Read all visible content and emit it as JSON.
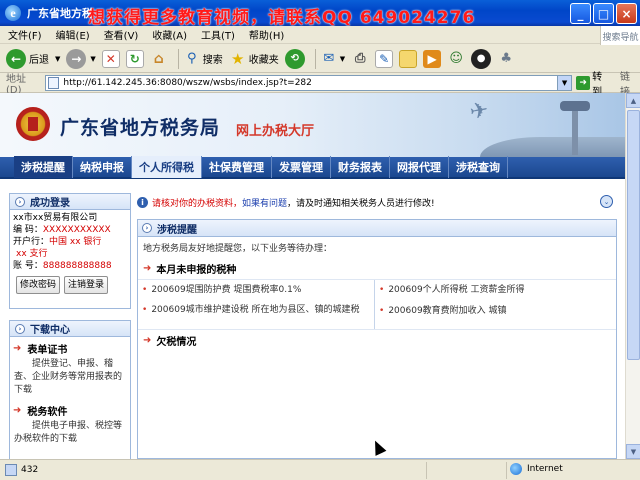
{
  "window": {
    "title": "广东省地方税",
    "watermark": "想获得更多教育视频，请联系QQ  649024276",
    "min_label": "_",
    "max_label": "□",
    "close_label": "×"
  },
  "menu": {
    "items": [
      "文件(F)",
      "编辑(E)",
      "查看(V)",
      "收藏(A)",
      "工具(T)",
      "帮助(H)"
    ],
    "logo": "搜索导航"
  },
  "toolbar": {
    "back_label": "后退",
    "search_label": "搜索",
    "favorites_label": "收藏夹"
  },
  "address": {
    "label": "地址(D)",
    "url": "http://61.142.245.36:8080/wszw/wsbs/index.jsp?t=282",
    "go_label": "转到",
    "links_label": "链接"
  },
  "banner": {
    "title": "广东省地方税务局",
    "subtitle": "网上办税大厅"
  },
  "nav": {
    "items": [
      "涉税提醒",
      "纳税申报",
      "个人所得税",
      "社保费管理",
      "发票管理",
      "财务报表",
      "网报代理",
      "涉税查询"
    ]
  },
  "login_panel": {
    "title": "成功登录",
    "company": "xx市xx贸易有限公司",
    "code_label": "编  码：",
    "code_value": "XXXXXXXXXXX",
    "bank_label": "开户行：",
    "bank_value": "中国 xx 银行",
    "branch_value": "xx 支行",
    "account_label": "账  号：",
    "account_value": "888888888888",
    "change_password_label": "修改密码",
    "logout_label": "注销登录"
  },
  "download_panel": {
    "title": "下载中心",
    "items": [
      {
        "title": "表单证书",
        "desc": "提供登记、申报、稽查、企业财务等常用报表的下载"
      },
      {
        "title": "税务软件",
        "desc": "提供电子申报、税控等办税软件的下载"
      }
    ]
  },
  "notice": {
    "prefix": "请核对你的办税资料，",
    "highlight": "如果有问题",
    "suffix": "，请及时通知相关税务人员进行修改!"
  },
  "reminder": {
    "title": "涉税提醒",
    "intro": "地方税务局友好地提醒您，以下业务等待办理：",
    "section_unpaid": "本月未申报的税种",
    "section_arrears": "欠税情况",
    "left_tasks": [
      "200609堤围防护费  堤围费税率0.1%",
      "200609城市维护建设税  所在地为县区、镇的城建税"
    ],
    "right_tasks": [
      "200609个人所得税  工资薪金所得",
      "200609教育费附加收入  城镇"
    ]
  },
  "status": {
    "progress": "432",
    "zone": "Internet"
  }
}
